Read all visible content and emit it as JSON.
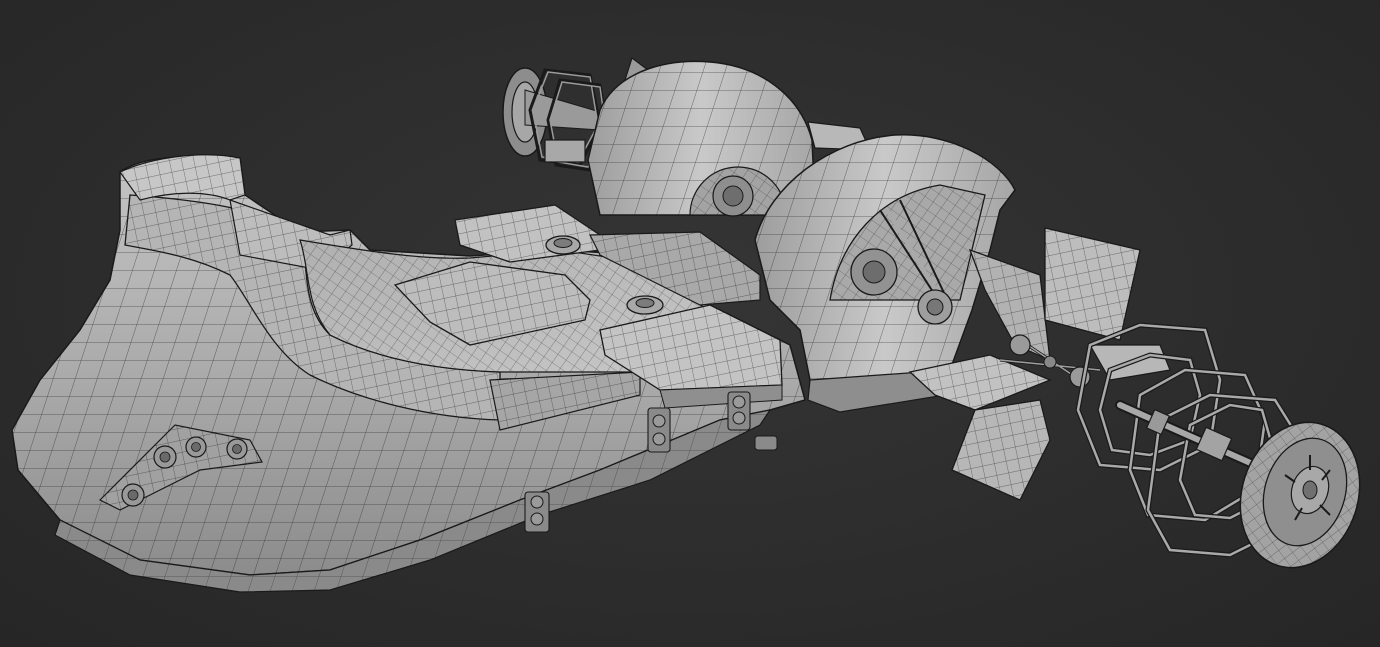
{
  "viewport": {
    "background": "#2b2b2b",
    "mesh_fill": "#b9b9b9",
    "mesh_shadow": "#7d7d7d",
    "mesh_highlight": "#d6d6d6",
    "wire_color": "#1b1b1b"
  },
  "model": {
    "subject": "paddle-boat-wireframe-mesh",
    "parts": [
      "hull",
      "deck",
      "paddle-wheel-housing-left",
      "paddle-wheel-housing-right",
      "paddle-wheel-exploded",
      "rear-paddle-assembly",
      "seat-panels",
      "bolts"
    ]
  }
}
